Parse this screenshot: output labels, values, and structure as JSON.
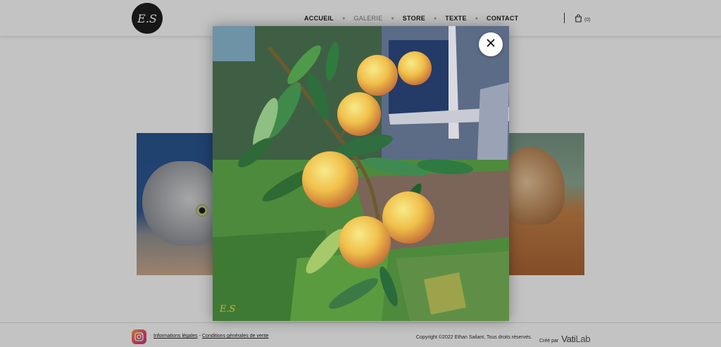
{
  "header": {
    "logo_text": "E.S",
    "nav": [
      {
        "label": "ACCUEIL"
      },
      {
        "label": "GALERIE"
      },
      {
        "label": "STORE"
      },
      {
        "label": "TEXTE"
      },
      {
        "label": "CONTACT"
      }
    ],
    "active_nav": "GALERIE",
    "nav_separator": "●",
    "cart_count": "(0)"
  },
  "lightbox": {
    "signature": "E.S",
    "close_icon": "close-icon"
  },
  "footer": {
    "legal_link": "Informations légales",
    "link_separator": " - ",
    "terms_link": "Conditions générales de vente",
    "copyright": "Copyright ©2022 Ethan Sailant, Tous droits réservés.",
    "created_by": "Créé par",
    "brand_vati": "Vati",
    "brand_lab": "Lab"
  },
  "icons": {
    "cart": "shopping-bag-icon",
    "instagram": "instagram-icon",
    "close": "close-icon"
  },
  "colors": {
    "logo_bg": "#111111",
    "overlay": "rgba(40,40,40,0.28)"
  }
}
